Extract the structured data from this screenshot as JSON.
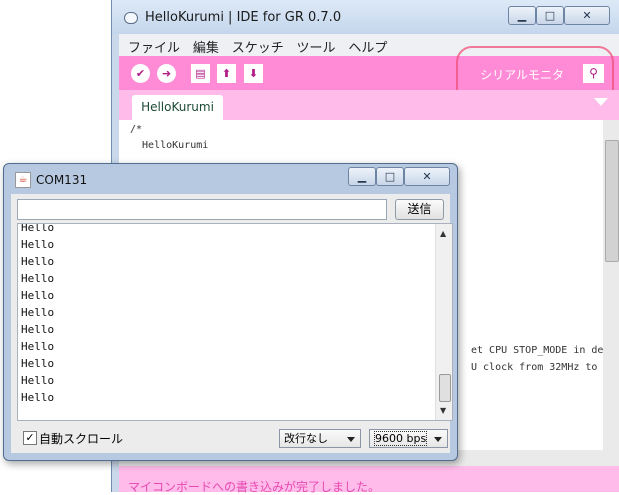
{
  "ide": {
    "title": "HelloKurumi | IDE for GR 0.7.0",
    "window_buttons": {
      "minimize": "▁",
      "maximize": "□",
      "close": "✕"
    },
    "menu": [
      "ファイル",
      "編集",
      "スケッチ",
      "ツール",
      "ヘルプ"
    ],
    "toolbar": {
      "verify_icon": "check-icon",
      "upload_icon": "arrow-right-icon",
      "new_icon": "document-icon",
      "open_icon": "arrow-up-icon",
      "save_icon": "arrow-down-icon",
      "serial_monitor_label": "シリアルモニタ",
      "serial_monitor_icon": "magnifier-icon"
    },
    "tab": "HelloKurumi",
    "code_lines": [
      "/*",
      "  HelloKurumi"
    ],
    "partial_code": [
      "et CPU STOP_MODE in del",
      "U clock from 32MHz to"
    ],
    "status": "マイコンボードへの書き込みが完了しました。",
    "colors": {
      "accent": "#ff8bd6",
      "tab_bar": "#ffbcea"
    }
  },
  "com": {
    "title": "COM131",
    "window_buttons": {
      "minimize": "▁",
      "maximize": "□",
      "close": "✕"
    },
    "input_value": "",
    "send_label": "送信",
    "output_lines": [
      "Hello",
      "Hello",
      "Hello",
      "Hello",
      "Hello",
      "Hello",
      "Hello",
      "Hello",
      "Hello",
      "Hello",
      "Hello"
    ],
    "autoscroll_label": "自動スクロール",
    "autoscroll_checked": true,
    "line_ending": "改行なし",
    "baud_rate": "9600 bps"
  }
}
